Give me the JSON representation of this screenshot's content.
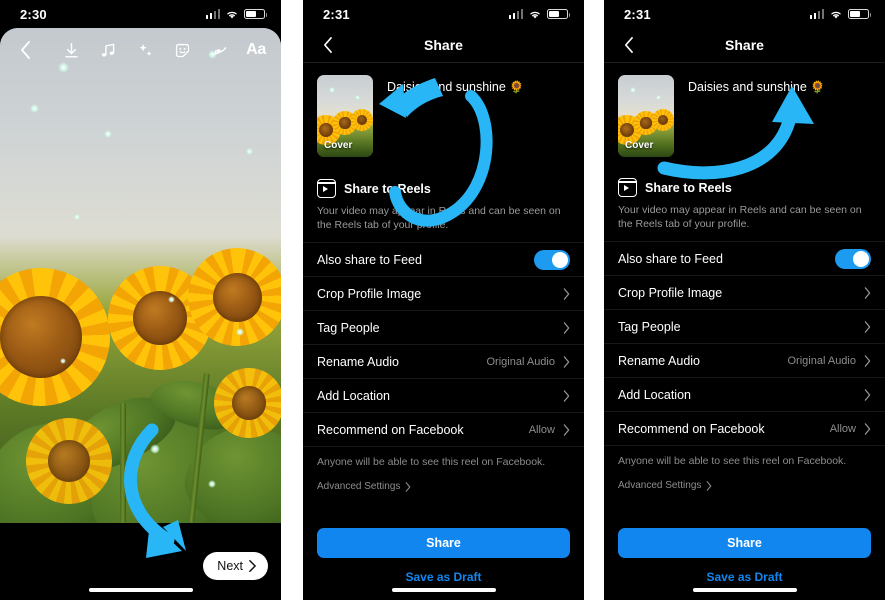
{
  "panels": [
    {
      "id": "editor",
      "status": {
        "time": "2:30"
      },
      "toolbar": {
        "back_icon": "chevron-left-icon",
        "icons": [
          {
            "name": "download-icon",
            "label": "Download"
          },
          {
            "name": "music-note-icon",
            "label": "Music"
          },
          {
            "name": "sparkles-effects-icon",
            "label": "Effects"
          },
          {
            "name": "sticker-smiley-icon",
            "label": "Stickers"
          },
          {
            "name": "draw-squiggle-icon",
            "label": "Draw"
          },
          {
            "name": "text-aa-icon",
            "label": "Aa"
          }
        ]
      },
      "next_button": {
        "label": "Next",
        "chevron": "chevron-right-icon"
      },
      "annotation": {
        "type": "curved-arrow",
        "color": "#29B6F6",
        "points_to": "next-button"
      }
    },
    {
      "id": "share-arrow-to-cover",
      "status": {
        "time": "2:31"
      },
      "header": {
        "title": "Share",
        "back_icon": "chevron-left-icon"
      },
      "cover": {
        "label": "Cover"
      },
      "caption": {
        "text": "Daisies and sunshine",
        "emoji": "🌻"
      },
      "reels": {
        "title": "Share to Reels",
        "description": "Your video may appear in Reels and can be seen on the Reels tab of your profile."
      },
      "rows": [
        {
          "label": "Also share to Feed",
          "type": "toggle",
          "value": "on"
        },
        {
          "label": "Crop Profile Image",
          "type": "chevron",
          "value": ""
        },
        {
          "label": "Tag People",
          "type": "chevron",
          "value": ""
        },
        {
          "label": "Rename Audio",
          "type": "chevron",
          "value": "Original Audio"
        },
        {
          "label": "Add Location",
          "type": "chevron",
          "value": ""
        },
        {
          "label": "Recommend on Facebook",
          "type": "chevron",
          "value": "Allow"
        }
      ],
      "note": "Anyone will be able to see this reel on Facebook.",
      "advanced": {
        "label": "Advanced Settings",
        "chevron": "chevron-right-icon"
      },
      "share_button": {
        "label": "Share"
      },
      "draft_link": {
        "label": "Save as Draft"
      },
      "annotation": {
        "type": "circular-arrow",
        "color": "#29B6F6",
        "points_to": "cover-thumbnail"
      }
    },
    {
      "id": "share-arrow-to-caption",
      "status": {
        "time": "2:31"
      },
      "header": {
        "title": "Share",
        "back_icon": "chevron-left-icon"
      },
      "cover": {
        "label": "Cover"
      },
      "caption": {
        "text": "Daisies and sunshine",
        "emoji": "🌻"
      },
      "reels": {
        "title": "Share to Reels",
        "description": "Your video may appear in Reels and can be seen on the Reels tab of your profile."
      },
      "rows": [
        {
          "label": "Also share to Feed",
          "type": "toggle",
          "value": "on"
        },
        {
          "label": "Crop Profile Image",
          "type": "chevron",
          "value": ""
        },
        {
          "label": "Tag People",
          "type": "chevron",
          "value": ""
        },
        {
          "label": "Rename Audio",
          "type": "chevron",
          "value": "Original Audio"
        },
        {
          "label": "Add Location",
          "type": "chevron",
          "value": ""
        },
        {
          "label": "Recommend on Facebook",
          "type": "chevron",
          "value": "Allow"
        }
      ],
      "note": "Anyone will be able to see this reel on Facebook.",
      "advanced": {
        "label": "Advanced Settings",
        "chevron": "chevron-right-icon"
      },
      "share_button": {
        "label": "Share"
      },
      "draft_link": {
        "label": "Save as Draft"
      },
      "annotation": {
        "type": "curved-arrow-up",
        "color": "#29B6F6",
        "points_to": "caption-text"
      }
    }
  ],
  "colors": {
    "accent_blue": "#1D9BF0",
    "annotation_blue": "#29B6F6",
    "screen_black": "#000000",
    "muted_text": "#8d8d8d"
  }
}
